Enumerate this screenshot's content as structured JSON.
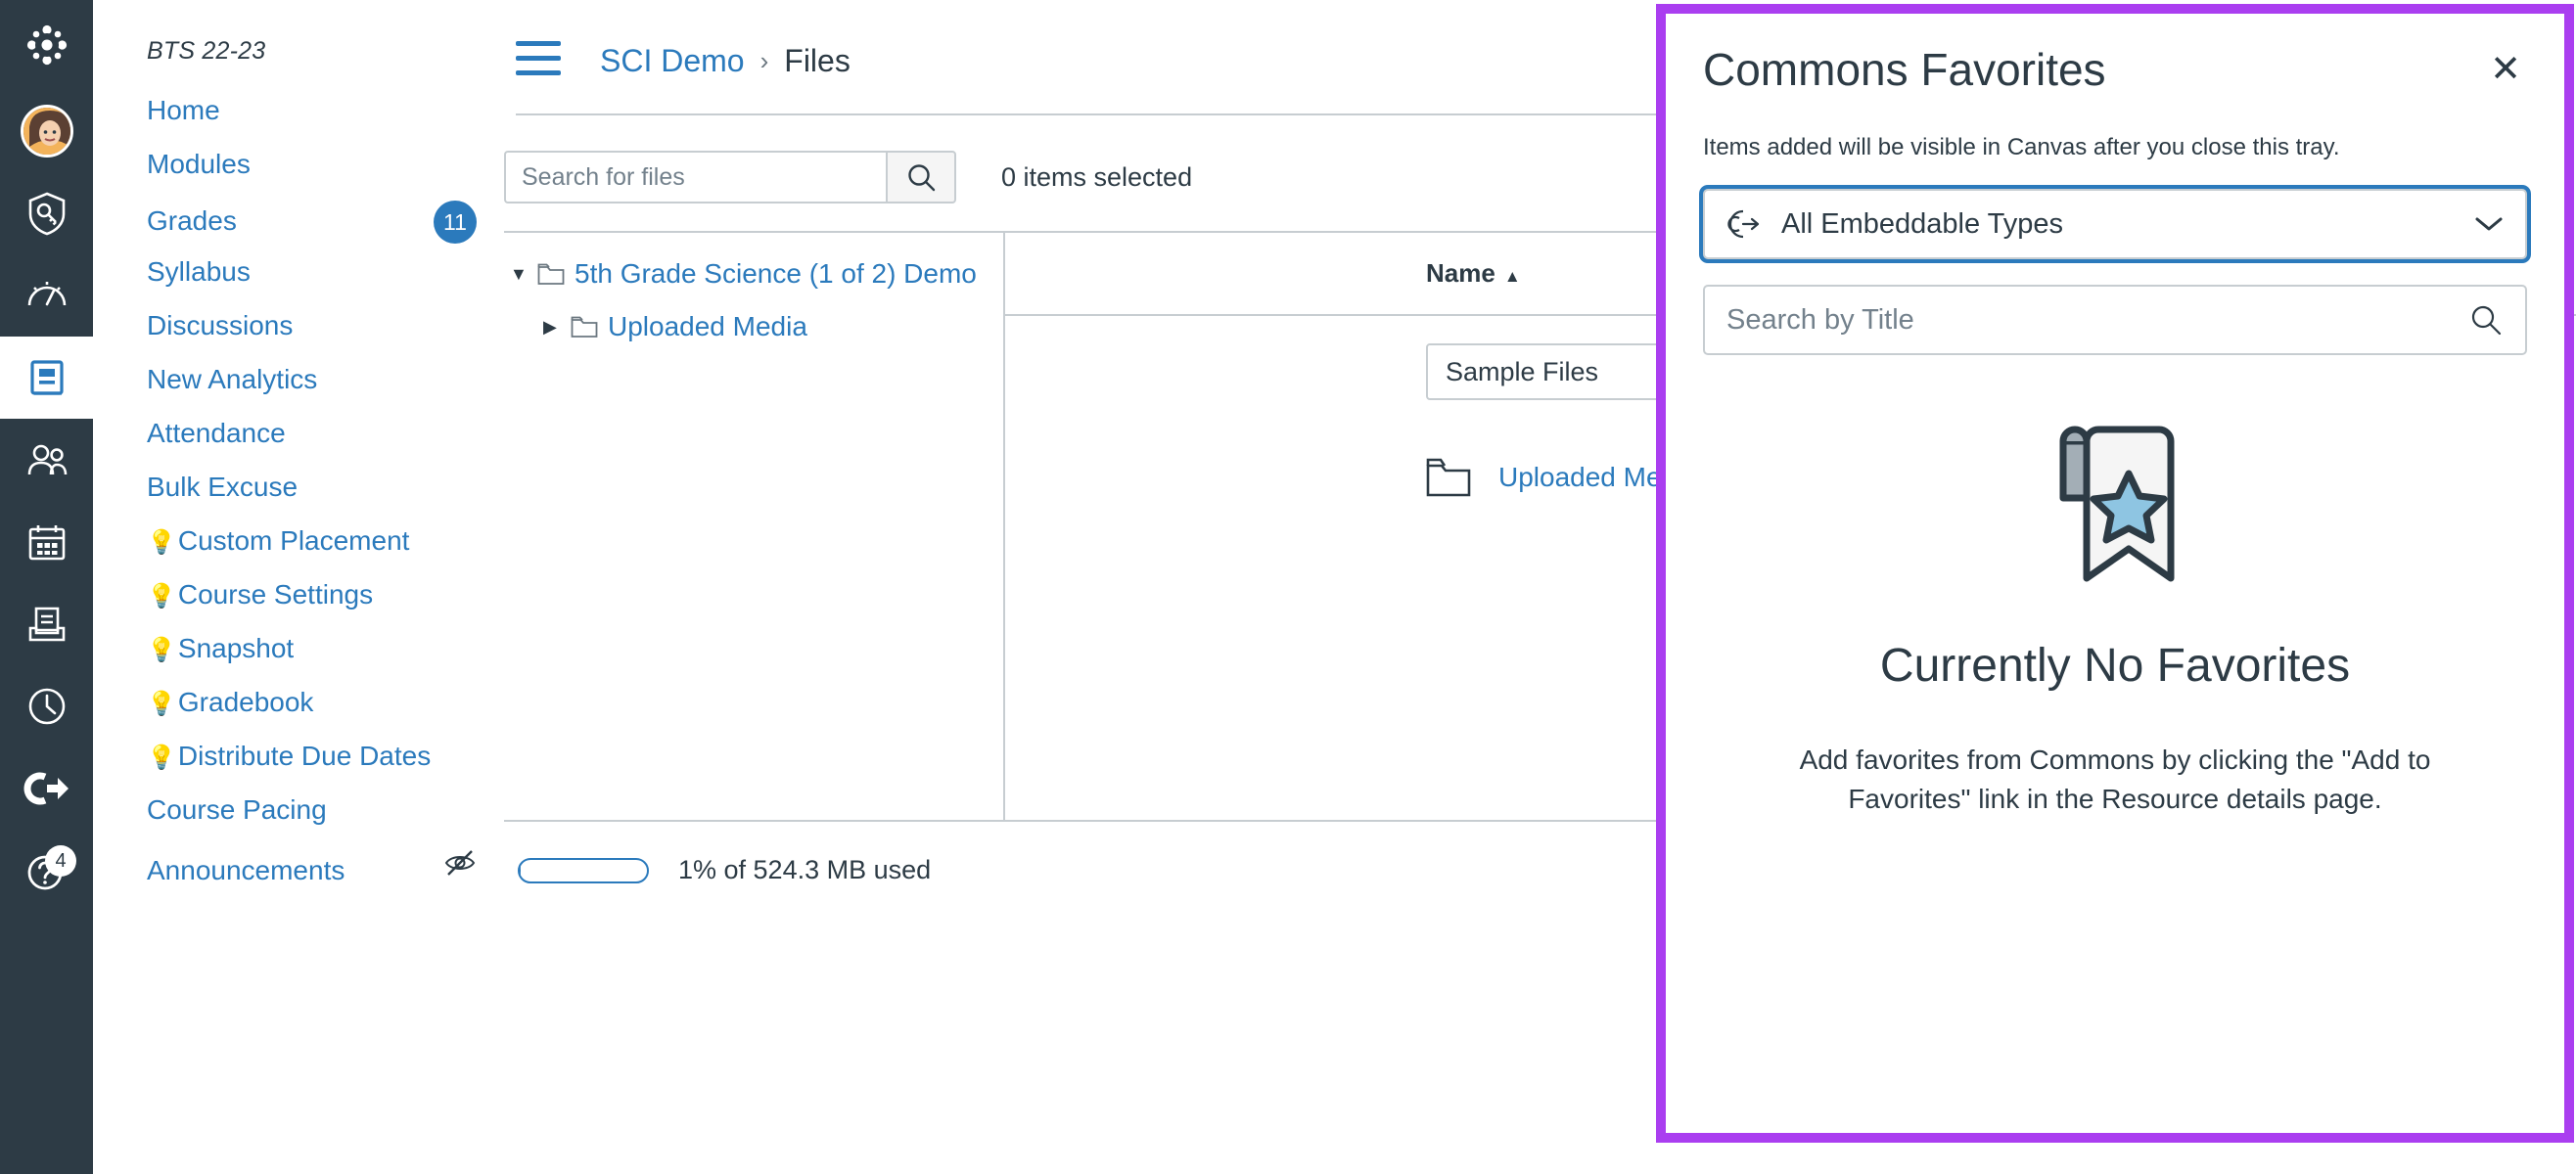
{
  "rail": {
    "items": [
      {
        "name": "canvas-logo-icon",
        "label": "Canvas"
      },
      {
        "name": "account-avatar",
        "label": "Account"
      },
      {
        "name": "admin-icon",
        "label": "Admin"
      },
      {
        "name": "dashboard-icon",
        "label": "Dashboard"
      },
      {
        "name": "courses-icon",
        "label": "Courses"
      },
      {
        "name": "groups-icon",
        "label": "Groups"
      },
      {
        "name": "calendar-icon",
        "label": "Calendar"
      },
      {
        "name": "inbox-icon",
        "label": "Inbox"
      },
      {
        "name": "history-icon",
        "label": "History"
      },
      {
        "name": "logout-icon",
        "label": "Commons"
      },
      {
        "name": "help-icon",
        "label": "Help"
      }
    ],
    "help_badge": "4"
  },
  "sidebar": {
    "course_code": "BTS 22-23",
    "items": [
      {
        "label": "Home",
        "bulb": false,
        "badge": null
      },
      {
        "label": "Modules",
        "bulb": false,
        "badge": null
      },
      {
        "label": "Grades",
        "bulb": false,
        "badge": "11"
      },
      {
        "label": "Syllabus",
        "bulb": false,
        "badge": null
      },
      {
        "label": "Discussions",
        "bulb": false,
        "badge": null
      },
      {
        "label": "New Analytics",
        "bulb": false,
        "badge": null
      },
      {
        "label": "Attendance",
        "bulb": false,
        "badge": null
      },
      {
        "label": "Bulk Excuse",
        "bulb": false,
        "badge": null
      },
      {
        "label": "Custom Placement",
        "bulb": true,
        "badge": null
      },
      {
        "label": "Course Settings",
        "bulb": true,
        "badge": null
      },
      {
        "label": "Snapshot",
        "bulb": true,
        "badge": null
      },
      {
        "label": " Gradebook",
        "bulb": true,
        "badge": null
      },
      {
        "label": "Distribute Due Dates",
        "bulb": true,
        "badge": null
      },
      {
        "label": "Course Pacing",
        "bulb": false,
        "badge": null
      },
      {
        "label": "Announcements",
        "bulb": false,
        "badge": null,
        "hidden_icon": true
      }
    ]
  },
  "breadcrumb": {
    "course": "SCI Demo",
    "separator": "›",
    "current": "Files"
  },
  "toolbar": {
    "search_placeholder": "Search for files",
    "search_value": "",
    "selection_status": "0 items selected"
  },
  "tree": {
    "nodes": [
      {
        "label": "5th Grade Science (1 of 2) Demo",
        "expanded": true,
        "indent": false
      },
      {
        "label": "Uploaded Media",
        "expanded": false,
        "indent": true
      }
    ]
  },
  "filelist": {
    "column_header": "Name",
    "sort_direction": "▲",
    "rename_value": "Sample Files",
    "confirm_label": "✓",
    "cancel_label": "✕",
    "rows": [
      {
        "name": "Uploaded Media",
        "icon": "folder-icon"
      }
    ]
  },
  "quota": {
    "percent": 1,
    "text": "1% of 524.3 MB used"
  },
  "tray": {
    "title": "Commons Favorites",
    "close_label": "✕",
    "subtitle": "Items added will be visible in Canvas after you close this tray.",
    "type_filter": {
      "selected": "All Embeddable Types"
    },
    "search": {
      "placeholder": "Search by Title",
      "value": ""
    },
    "empty": {
      "title": "Currently No Favorites",
      "body": "Add favorites from Commons by clicking the \"Add to Favorites\" link in the Resource details page."
    }
  },
  "colors": {
    "rail_bg": "#2D3B45",
    "link_blue": "#2B7ABC",
    "tray_border_purple": "#AA3EF0",
    "star_blue": "#8EC5E2",
    "border_gray": "#C7CDD1"
  }
}
